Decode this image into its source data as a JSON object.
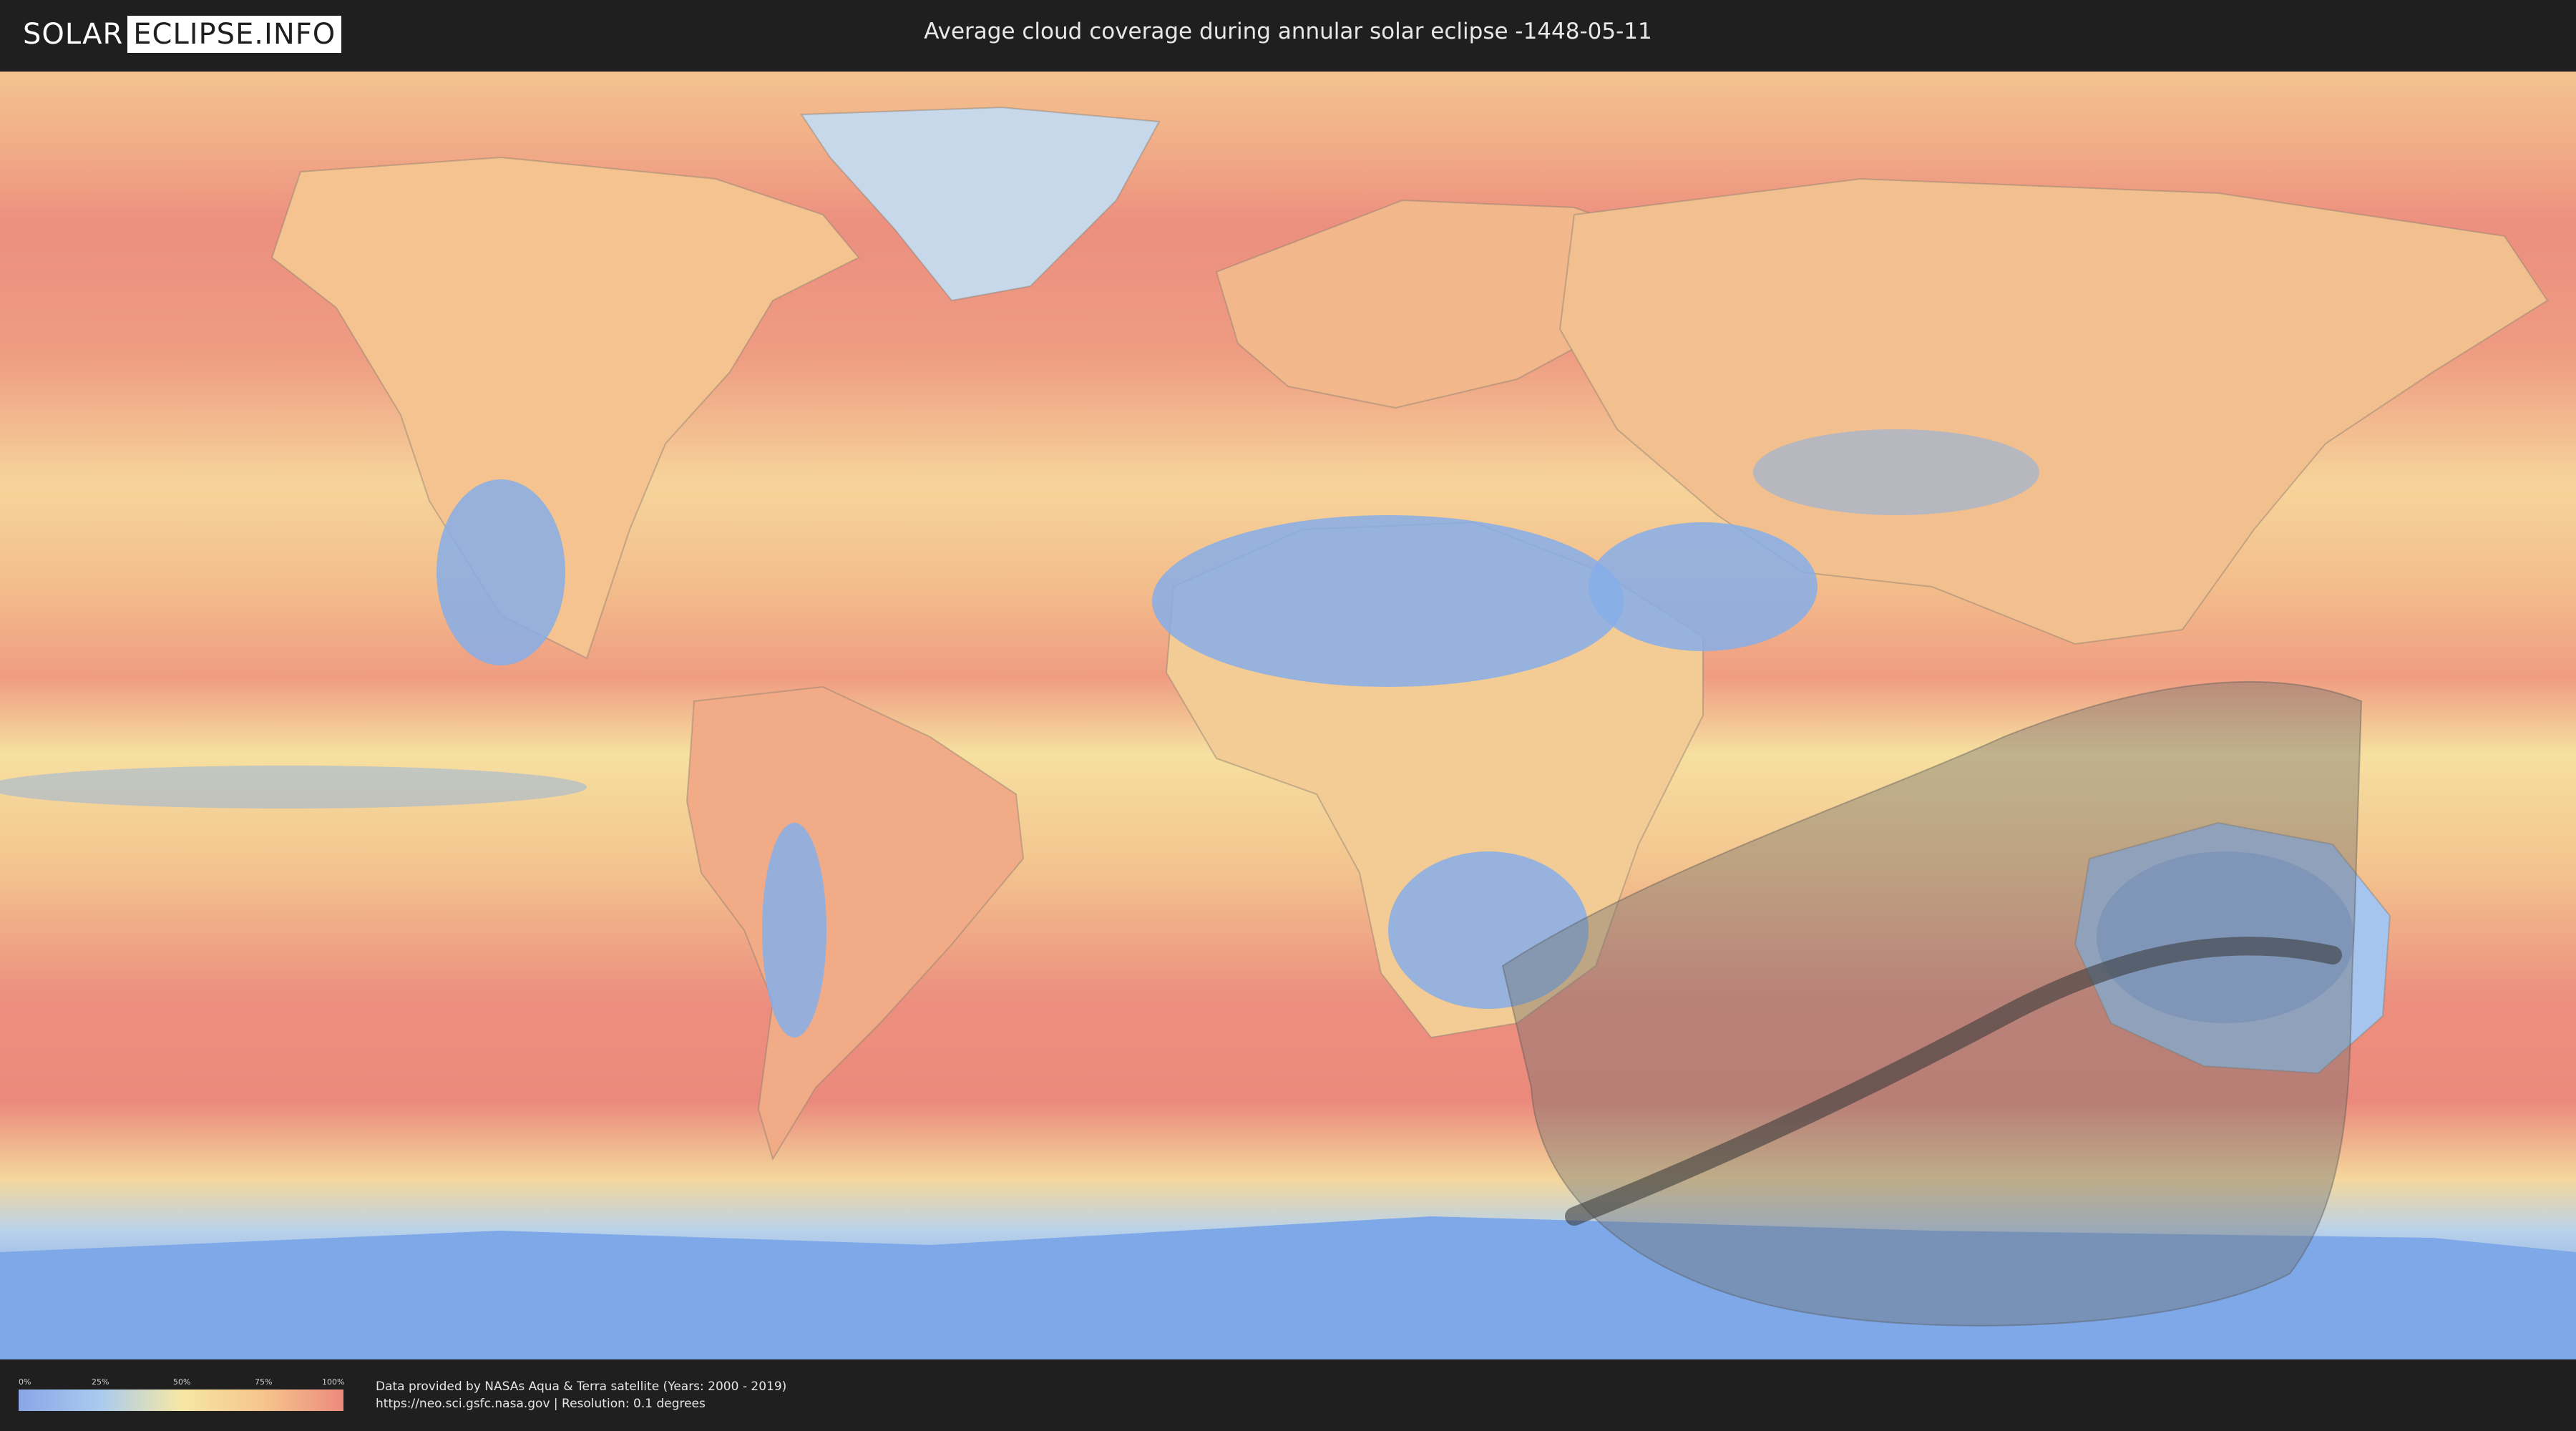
{
  "logo": {
    "left": "SOLAR",
    "right": "ECLIPSE.INFO"
  },
  "title": "Average cloud coverage during annular solar eclipse -1448-05-11",
  "scale": {
    "ticks": [
      "0%",
      "25%",
      "50%",
      "75%",
      "100%"
    ]
  },
  "credits": {
    "line1": "Data provided by NASAs Aqua & Terra satellite (Years: 2000 - 2019)",
    "line2": "https://neo.sci.gsfc.nasa.gov | Resolution: 0.1 degrees"
  },
  "colors": {
    "clear": "#7ea8e8",
    "low": "#a9cbef",
    "mid": "#f6e7a5",
    "high": "#f6c58d",
    "overcast": "#ec8b7d",
    "penumbra": "#6e6e6e",
    "umbra": "#3c3c3c"
  }
}
